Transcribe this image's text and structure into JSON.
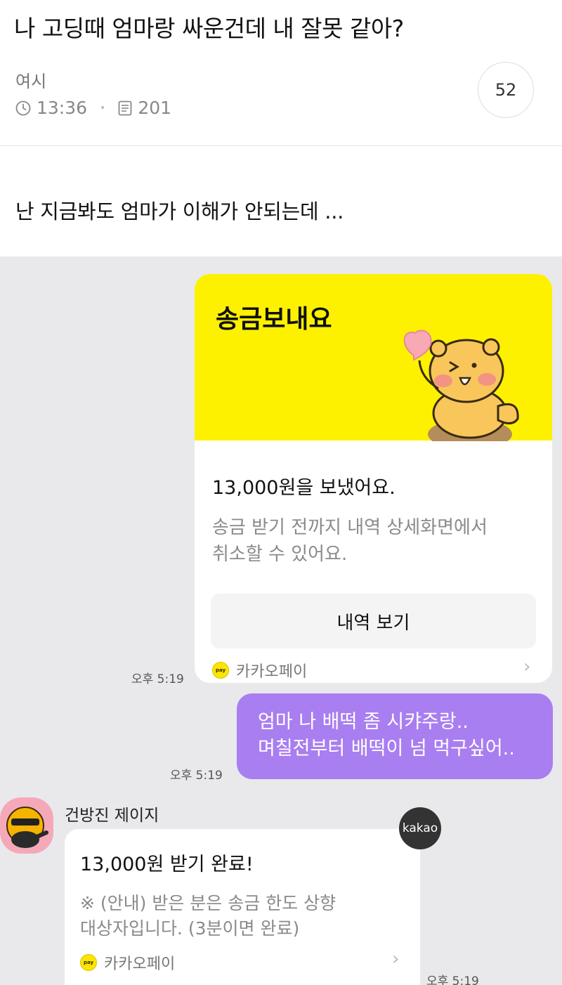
{
  "post": {
    "title": "나 고딩때 엄마랑 싸운건데 내 잘못 같아?",
    "author": "여시",
    "time": "13:36",
    "views": "201",
    "comment_count": "52",
    "body": "난 지금봐도 엄마가 이해가 안되는데 ..."
  },
  "chat": {
    "pay_card": {
      "banner_title": "송금보내요",
      "amount_text": "13,000원을 보냈어요.",
      "desc_lines": [
        "송금 받기 전까지 내역 상세화면에서",
        "취소할 수 있어요."
      ],
      "button_label": "내역 보기",
      "service": "카카오페이",
      "time": "오후 5:19"
    },
    "user_message": {
      "lines": [
        "엄마 나 배떡 좀 시캬주랑..",
        "며칠전부터 배떡이 넘 먹구싶어.."
      ],
      "time": "오후 5:19"
    },
    "reply": {
      "sender": "건방진 제이지",
      "badge": "kakao",
      "title": "13,000원 받기 완료!",
      "lines": [
        "※ (안내) 받은 분은 송금 한도 상향",
        "대상자입니다. (3분이면 완료)"
      ],
      "service": "카카오페이",
      "time": "오후 5:19"
    }
  },
  "colors": {
    "pay_yellow": "#fef100",
    "bubble_purple": "#a97ef0",
    "chat_bg": "#e9e9ec"
  },
  "icons": {
    "clock": "clock-icon",
    "views": "document-icon",
    "chevron": "chevron-right-icon",
    "pay": "kakaopay-logo-icon"
  }
}
